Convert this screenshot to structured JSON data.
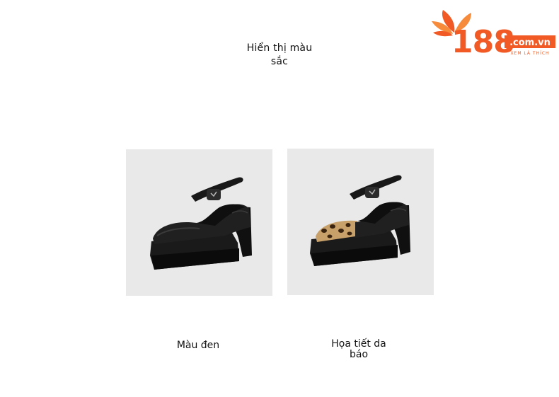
{
  "header": {
    "title": "Hiển thị màu sắc"
  },
  "logo": {
    "number": "188",
    "domain": ".com.vn",
    "tagline": "XEM LÀ THÍCH",
    "brand_color": "#f15a24"
  },
  "products": [
    {
      "caption": "Màu đen",
      "image": "black-mary-jane-platform-heel"
    },
    {
      "caption": "Họa tiết da báo",
      "image": "leopard-print-mary-jane-platform-heel"
    }
  ],
  "colors": {
    "photo_background": "#e9e9e9",
    "shoe_leather": "#141414"
  }
}
